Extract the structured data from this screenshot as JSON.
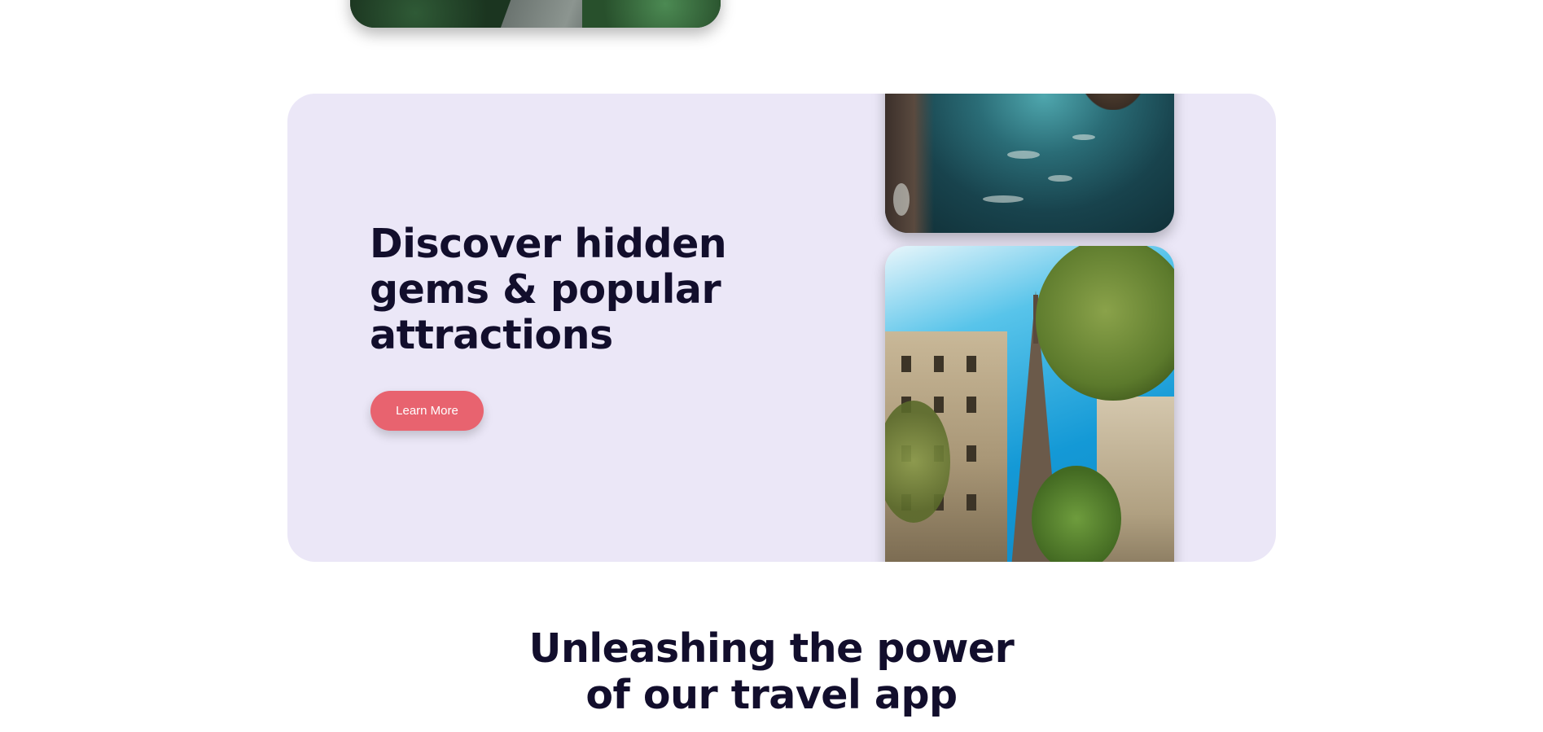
{
  "feature": {
    "title": "Discover hidden gems & popular attractions",
    "button_label": "Learn More",
    "accent_color": "#e8636f",
    "panel_color": "#ebe7f7"
  },
  "section": {
    "heading_line1": "Unleashing the power",
    "heading_line2": "of our travel app",
    "heading_color": "#120e2c"
  },
  "images": {
    "top": "street-photo",
    "coast": "coastline-aerial-photo",
    "paris": "eiffel-tower-street-photo"
  }
}
